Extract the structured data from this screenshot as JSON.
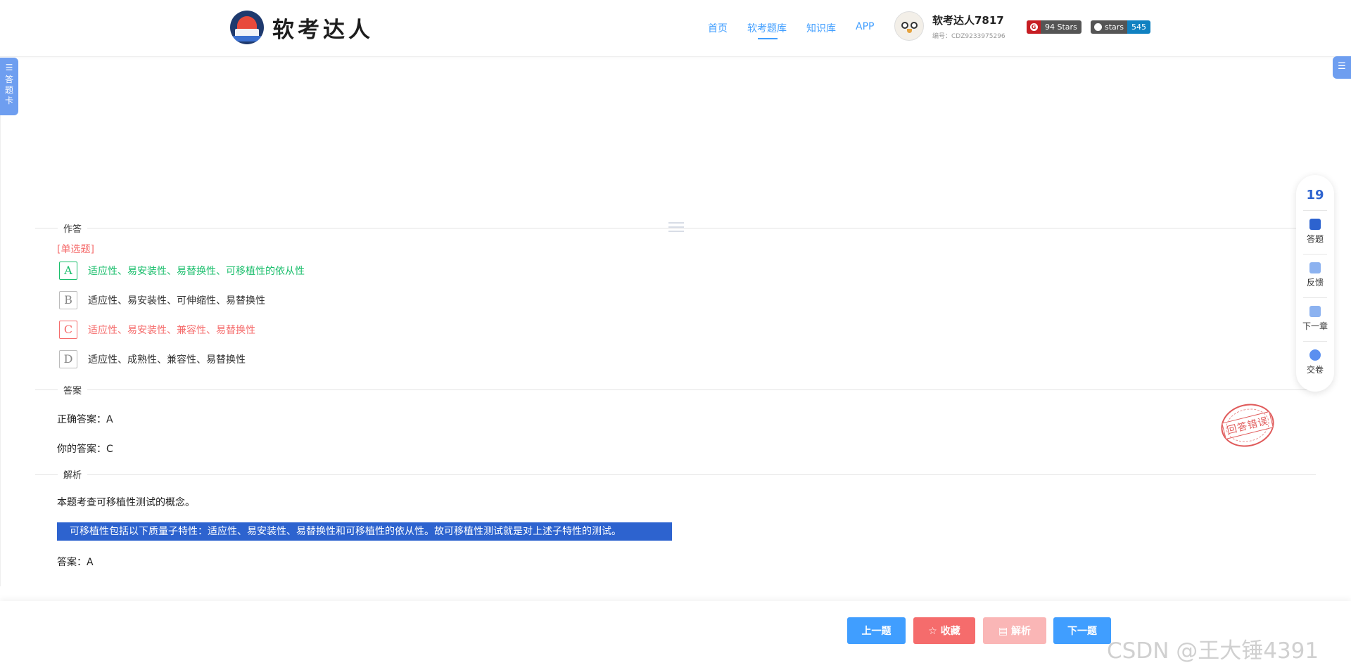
{
  "header": {
    "logo_text": "软考达人",
    "nav": [
      {
        "label": "首页",
        "active": false
      },
      {
        "label": "软考题库",
        "active": true
      },
      {
        "label": "知识库",
        "active": false
      },
      {
        "label": "APP",
        "active": false
      }
    ],
    "user": {
      "name": "软考达人7817",
      "id": "编号：CDZ9233975296"
    },
    "gitee_badge": "94 Stars",
    "github_badge": {
      "label": "stars",
      "count": "545"
    }
  },
  "side": {
    "answer_card_label": "答题卡",
    "list_icon": "list-icon"
  },
  "sections": {
    "answer_area": "作答",
    "answer": "答案",
    "analysis": "解析"
  },
  "question": {
    "type": "[单选题]",
    "options": [
      {
        "letter": "A",
        "text": "适应性、易安装性、易替换性、可移植性的依从性",
        "state": "correct"
      },
      {
        "letter": "B",
        "text": "适应性、易安装性、可伸缩性、易替换性",
        "state": "normal"
      },
      {
        "letter": "C",
        "text": "适应性、易安装性、兼容性、易替换性",
        "state": "wrong"
      },
      {
        "letter": "D",
        "text": "适应性、成熟性、兼容性、易替换性",
        "state": "normal"
      }
    ]
  },
  "answer": {
    "correct_label": "正确答案：A",
    "yours_label": "你的答案：C",
    "stamp": "回答错误"
  },
  "analysis": {
    "line1": "本题考查可移植性测试的概念。",
    "highlight": "可移植性包括以下质量子特性：适应性、易安装性、易替换性和可移植性的依从性。故可移植性测试就是对上述子特性的测试。",
    "line3": "答案：A"
  },
  "float_bar": {
    "count": "19",
    "items": [
      "答题",
      "反馈",
      "下一章",
      "交卷"
    ]
  },
  "buttons": {
    "prev": "上一题",
    "fav": "☆ 收藏",
    "analysis": "▤ 解析",
    "next": "下一题"
  },
  "watermark": "CSDN @王大锤4391",
  "colors": {
    "primary": "#409eff",
    "correct": "#19be6b",
    "wrong": "#f56c6c",
    "highlight_bg": "#2d63cf"
  }
}
